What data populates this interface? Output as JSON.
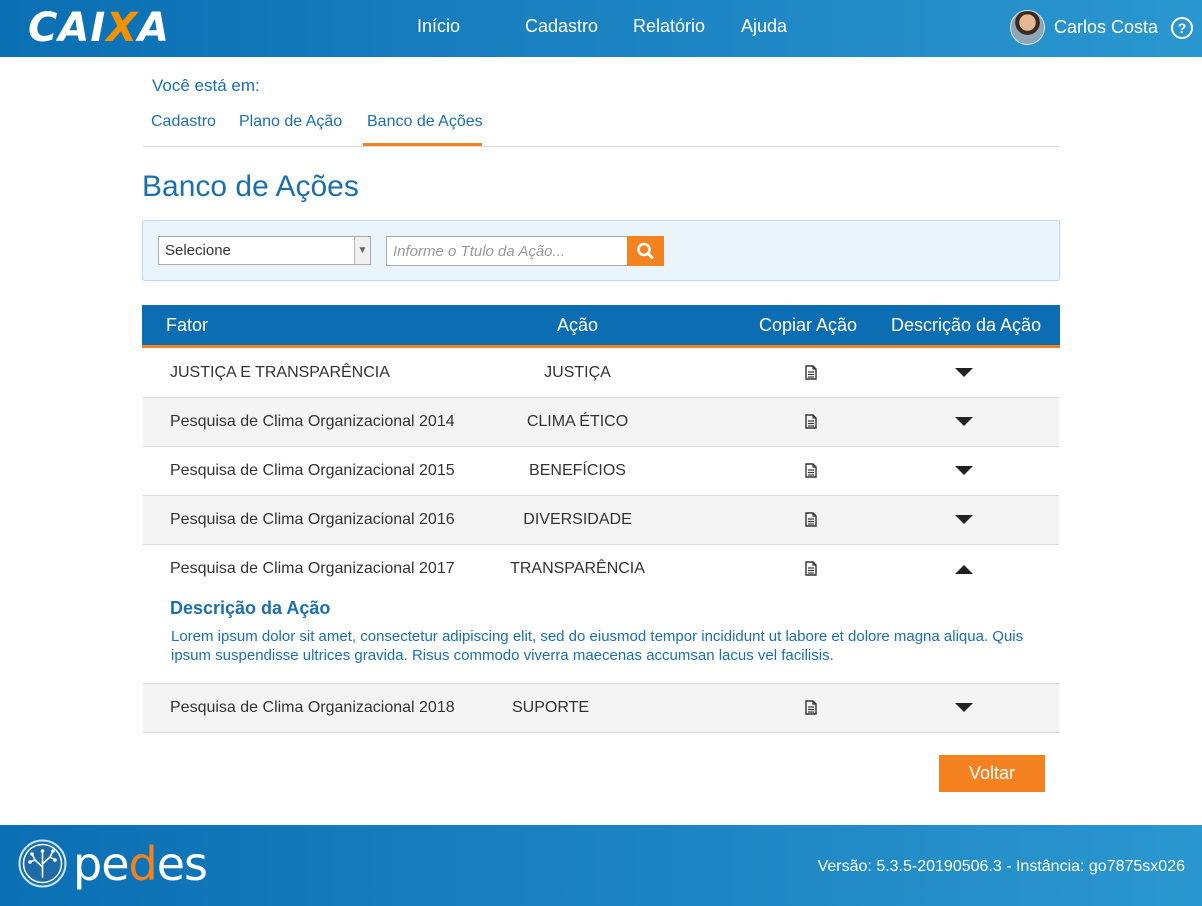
{
  "header": {
    "logo": {
      "pre": "CAI",
      "x": "X",
      "post": "A"
    },
    "nav": [
      "Início",
      "Cadastro",
      "Relatório",
      "Ajuda"
    ],
    "user_name": "Carlos Costa",
    "help_label": "?"
  },
  "breadcrumb": {
    "label": "Você está em:",
    "items": [
      "Cadastro",
      "Plano de Ação",
      "Banco de Ações"
    ],
    "active_index": 2
  },
  "page_title": "Banco de Ações",
  "filter": {
    "select_value": "Selecione",
    "search_placeholder": "Informe o Ttulo da Ação..."
  },
  "table": {
    "headers": [
      "Fator",
      "Ação",
      "Copiar Ação",
      "Descrição da Ação"
    ],
    "rows": [
      {
        "fator": "JUSTIÇA E TRANSPARÊNCIA",
        "acao": "JUSTIÇA"
      },
      {
        "fator": "Pesquisa de Clima Organizacional 2014",
        "acao": "CLIMA ÉTICO"
      },
      {
        "fator": "Pesquisa de Clima Organizacional 2015",
        "acao": "BENEFÍCIOS"
      },
      {
        "fator": "Pesquisa de Clima Organizacional 2016",
        "acao": "DIVERSIDADE"
      },
      {
        "fator": "Pesquisa de Clima Organizacional 2017",
        "acao": "TRANSPARÊNCIA"
      },
      {
        "fator": "Pesquisa de Clima Organizacional 2018",
        "acao": "SUPORTE"
      }
    ],
    "expanded_row": 4,
    "expanded": {
      "title": "Descrição da Ação",
      "text": "Lorem ipsum dolor sit amet, consectetur adipiscing elit, sed do eiusmod tempor incididunt ut labore et dolore magna aliqua. Quis ipsum suspendisse ultrices gravida. Risus commodo viverra maecenas accumsan lacus vel facilisis."
    }
  },
  "back_button": "Voltar",
  "footer": {
    "brand": {
      "pe": "pe",
      "d": "d",
      "es": "es"
    },
    "version": "Versão: 5.3.5-20190506.3 - Instância: go7875sx026"
  },
  "colors": {
    "primary": "#0d6db3",
    "accent": "#f58220",
    "link": "#1b6fae"
  },
  "icons": [
    "search-icon",
    "document-icon",
    "caret-down-icon",
    "caret-up-icon",
    "help-icon"
  ]
}
